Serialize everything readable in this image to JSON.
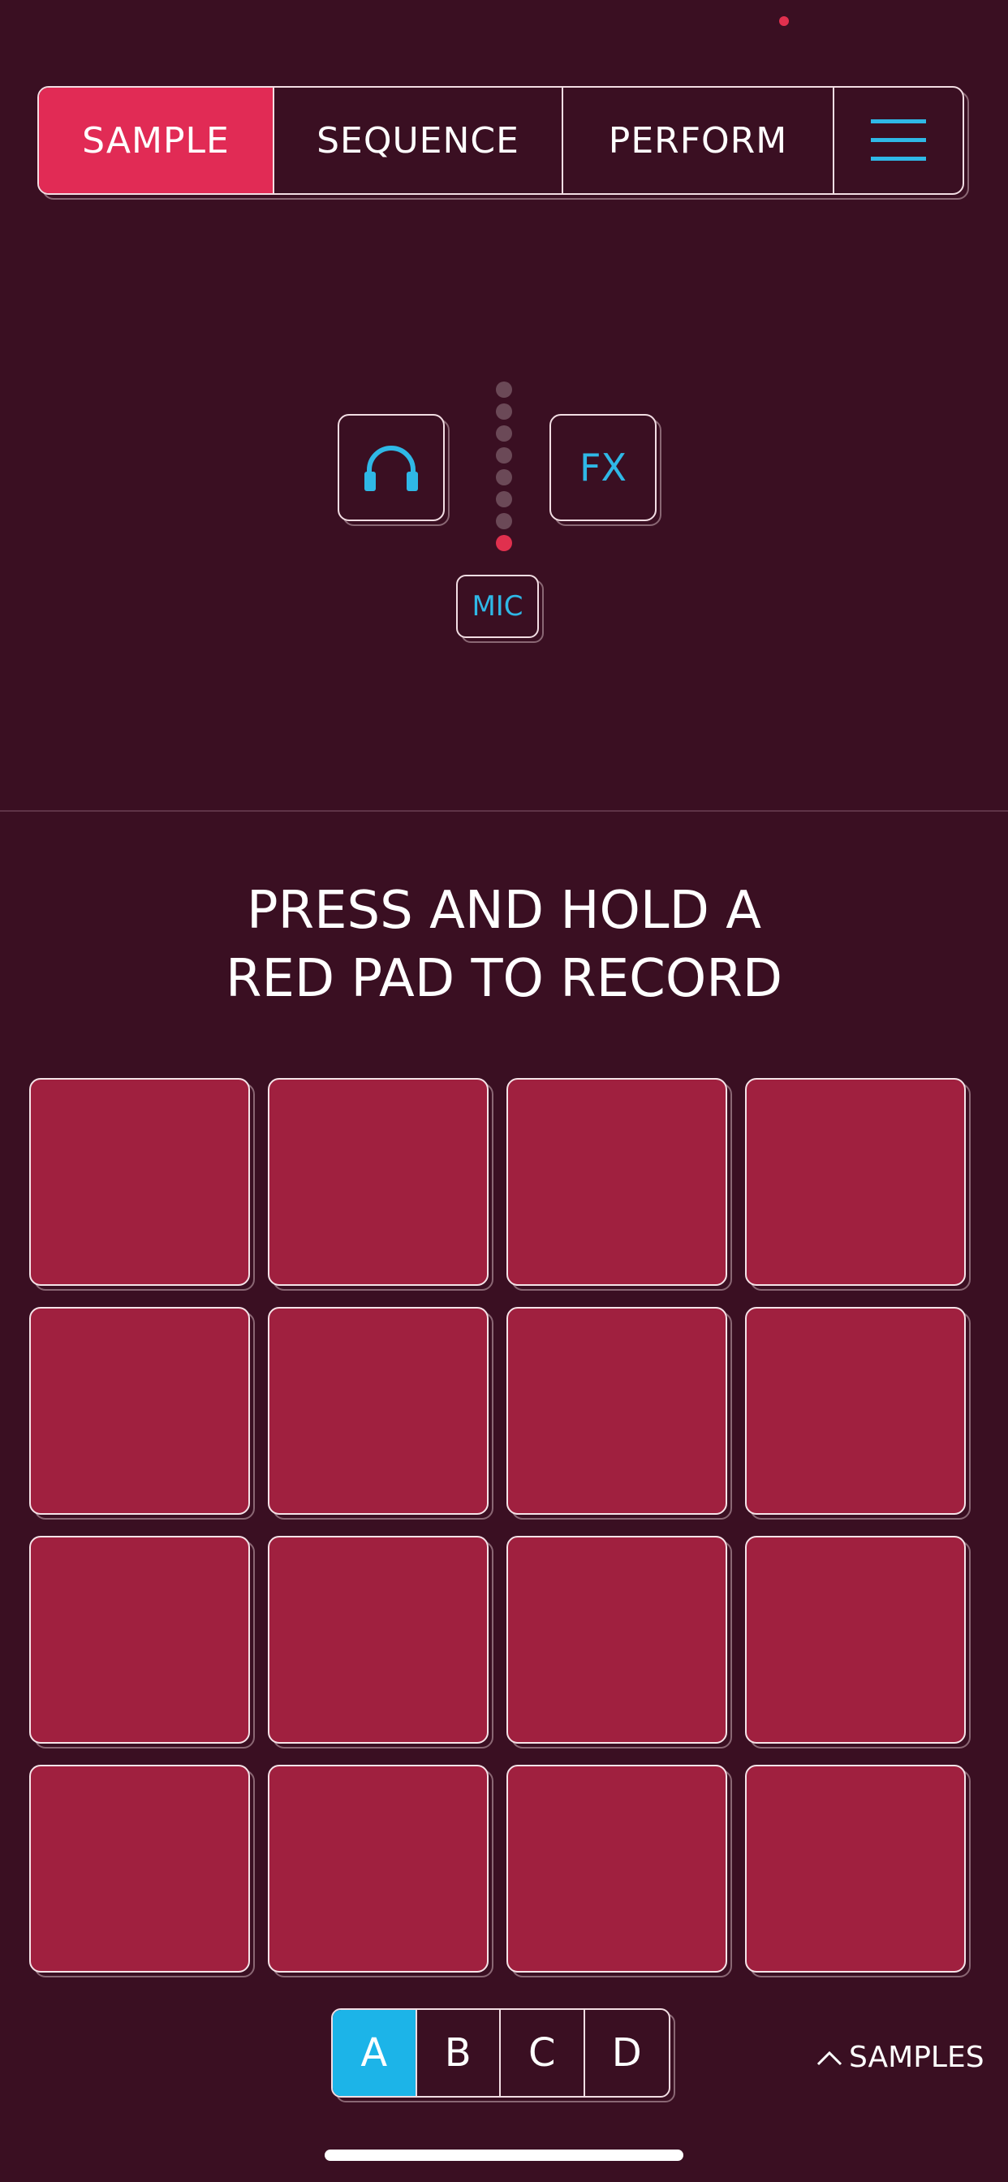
{
  "nav": {
    "tabs": [
      {
        "label": "SAMPLE",
        "active": true
      },
      {
        "label": "SEQUENCE",
        "active": false
      },
      {
        "label": "PERFORM",
        "active": false
      }
    ],
    "menu_icon": "hamburger-menu-icon"
  },
  "controls": {
    "headphones_icon": "headphones-icon",
    "fx_label": "FX",
    "mic_label": "MIC",
    "level_meter": {
      "total_dots": 8,
      "active_dots": 1
    }
  },
  "instruction": {
    "line1": "PRESS AND HOLD A",
    "line2": "RED PAD TO RECORD"
  },
  "pads": {
    "rows": 4,
    "cols": 4,
    "count": 16
  },
  "banks": {
    "items": [
      "A",
      "B",
      "C",
      "D"
    ],
    "selected": "A"
  },
  "samples_link": {
    "label": "SAMPLES",
    "icon": "chevron-up-icon"
  },
  "colors": {
    "background": "#3a0f22",
    "accent_red": "#e12b55",
    "pad_red": "#a0203f",
    "accent_blue": "#1cb4e8",
    "meter_active": "#e0304e"
  }
}
